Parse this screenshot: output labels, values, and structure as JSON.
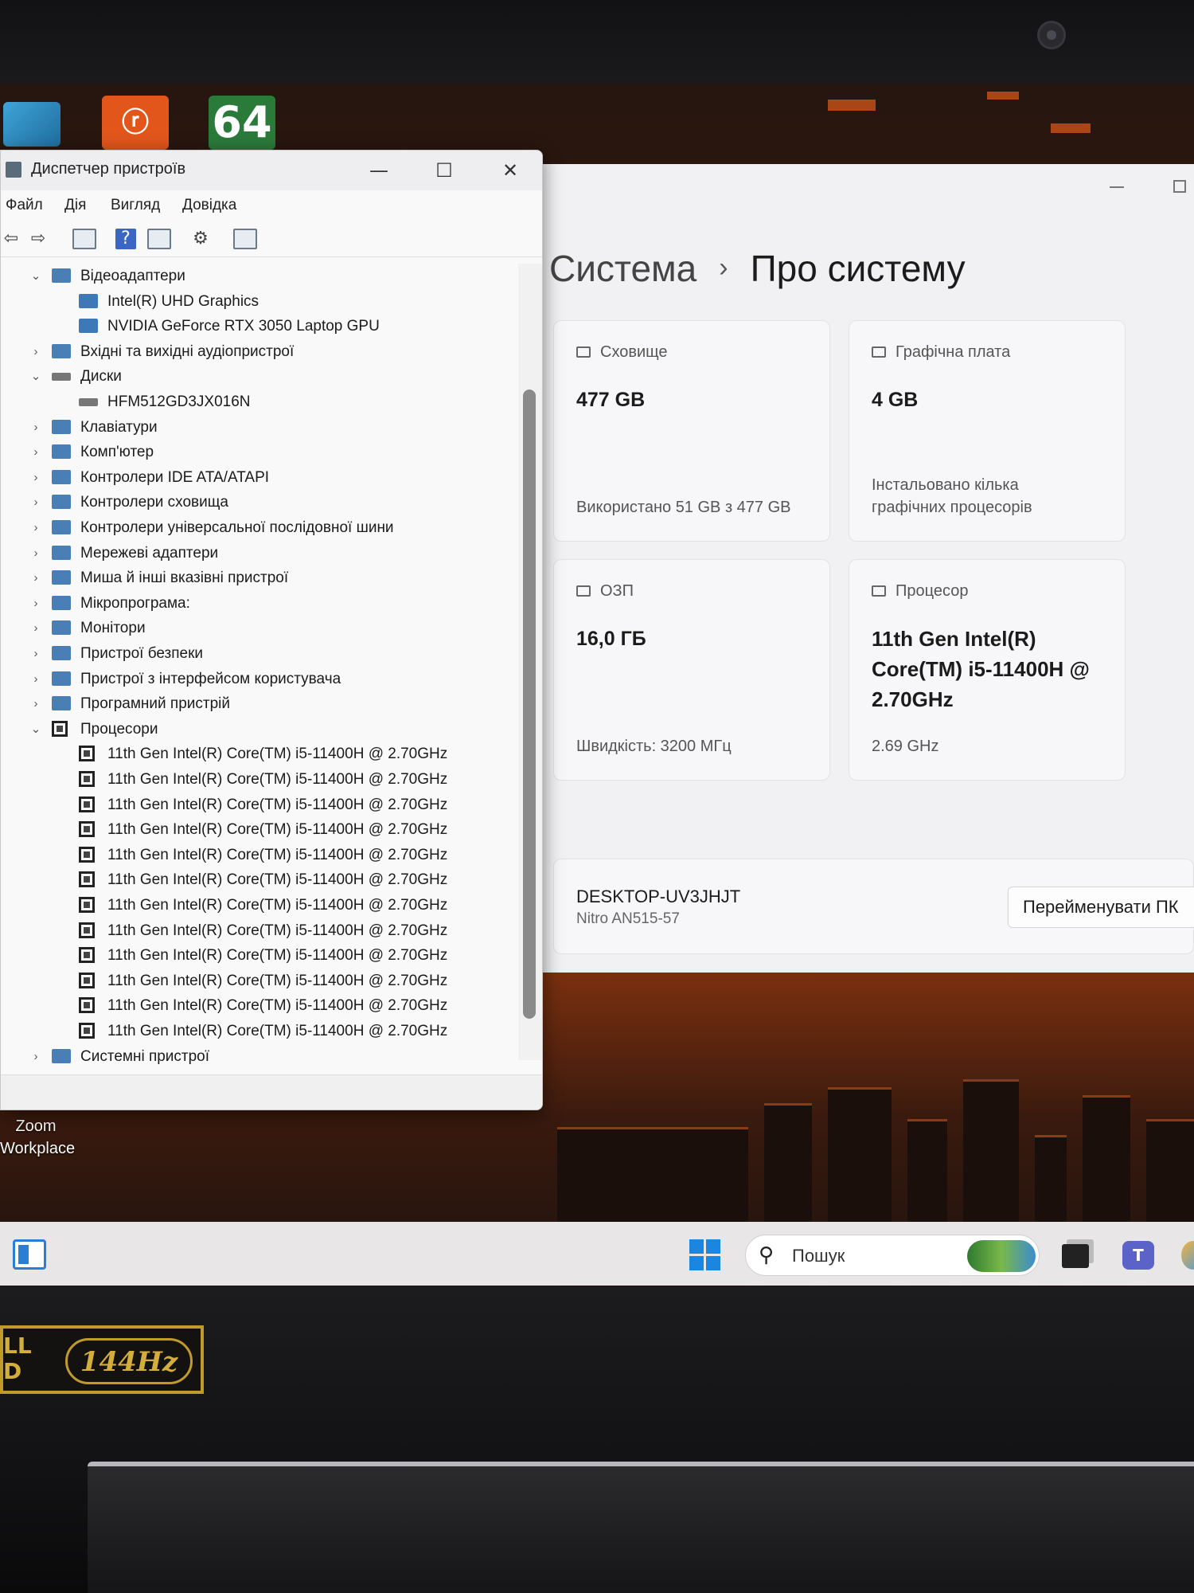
{
  "desktop": {
    "icons": [
      {
        "name": "blue-app",
        "label": ""
      },
      {
        "name": "reader",
        "label": "ⓡ"
      },
      {
        "name": "aida64",
        "label": "64"
      }
    ],
    "zoom_label_1": "Zoom",
    "zoom_label_2": "Workplace"
  },
  "device_manager": {
    "title": "Диспетчер пристроїв",
    "menu": [
      "Файл",
      "Дія",
      "Вигляд",
      "Довідка"
    ],
    "window_buttons": {
      "minimize": "—",
      "maximize": "☐",
      "close": "✕"
    },
    "tree": [
      {
        "label": "Відеоадаптери",
        "level": 0,
        "expanded": true,
        "icon": "display-adapter-icon"
      },
      {
        "label": "Intel(R) UHD Graphics",
        "level": 1,
        "icon": "gpu-icon"
      },
      {
        "label": "NVIDIA GeForce RTX 3050 Laptop GPU",
        "level": 1,
        "icon": "gpu-icon"
      },
      {
        "label": "Вхідні та вихідні аудіопристрої",
        "level": 0,
        "expanded": false,
        "icon": "speaker-icon"
      },
      {
        "label": "Диски",
        "level": 0,
        "expanded": true,
        "icon": "disk-icon"
      },
      {
        "label": "HFM512GD3JX016N",
        "level": 1,
        "icon": "disk-icon"
      },
      {
        "label": "Клавіатури",
        "level": 0,
        "expanded": false,
        "icon": "keyboard-icon"
      },
      {
        "label": "Комп'ютер",
        "level": 0,
        "expanded": false,
        "icon": "computer-icon"
      },
      {
        "label": "Контролери IDE ATA/ATAPI",
        "level": 0,
        "expanded": false,
        "icon": "ide-icon"
      },
      {
        "label": "Контролери сховища",
        "level": 0,
        "expanded": false,
        "icon": "storage-controller-icon"
      },
      {
        "label": "Контролери універсальної послідовної шини",
        "level": 0,
        "expanded": false,
        "icon": "usb-icon"
      },
      {
        "label": "Мережеві адаптери",
        "level": 0,
        "expanded": false,
        "icon": "network-icon"
      },
      {
        "label": "Миша й інші вказівні пристрої",
        "level": 0,
        "expanded": false,
        "icon": "mouse-icon"
      },
      {
        "label": "Мікропрограма:",
        "level": 0,
        "expanded": false,
        "icon": "firmware-icon"
      },
      {
        "label": "Монітори",
        "level": 0,
        "expanded": false,
        "icon": "monitor-icon"
      },
      {
        "label": "Пристрої безпеки",
        "level": 0,
        "expanded": false,
        "icon": "security-icon"
      },
      {
        "label": "Пристрої з інтерфейсом користувача",
        "level": 0,
        "expanded": false,
        "icon": "hid-icon"
      },
      {
        "label": "Програмний пристрій",
        "level": 0,
        "expanded": false,
        "icon": "software-device-icon"
      },
      {
        "label": "Процесори",
        "level": 0,
        "expanded": true,
        "icon": "processor-icon"
      },
      {
        "label": "11th Gen Intel(R) Core(TM) i5-11400H @ 2.70GHz",
        "level": 1,
        "icon": "cpu-icon"
      },
      {
        "label": "11th Gen Intel(R) Core(TM) i5-11400H @ 2.70GHz",
        "level": 1,
        "icon": "cpu-icon"
      },
      {
        "label": "11th Gen Intel(R) Core(TM) i5-11400H @ 2.70GHz",
        "level": 1,
        "icon": "cpu-icon"
      },
      {
        "label": "11th Gen Intel(R) Core(TM) i5-11400H @ 2.70GHz",
        "level": 1,
        "icon": "cpu-icon"
      },
      {
        "label": "11th Gen Intel(R) Core(TM) i5-11400H @ 2.70GHz",
        "level": 1,
        "icon": "cpu-icon"
      },
      {
        "label": "11th Gen Intel(R) Core(TM) i5-11400H @ 2.70GHz",
        "level": 1,
        "icon": "cpu-icon"
      },
      {
        "label": "11th Gen Intel(R) Core(TM) i5-11400H @ 2.70GHz",
        "level": 1,
        "icon": "cpu-icon"
      },
      {
        "label": "11th Gen Intel(R) Core(TM) i5-11400H @ 2.70GHz",
        "level": 1,
        "icon": "cpu-icon"
      },
      {
        "label": "11th Gen Intel(R) Core(TM) i5-11400H @ 2.70GHz",
        "level": 1,
        "icon": "cpu-icon"
      },
      {
        "label": "11th Gen Intel(R) Core(TM) i5-11400H @ 2.70GHz",
        "level": 1,
        "icon": "cpu-icon"
      },
      {
        "label": "11th Gen Intel(R) Core(TM) i5-11400H @ 2.70GHz",
        "level": 1,
        "icon": "cpu-icon"
      },
      {
        "label": "11th Gen Intel(R) Core(TM) i5-11400H @ 2.70GHz",
        "level": 1,
        "icon": "cpu-icon"
      },
      {
        "label": "Системні пристрої",
        "level": 0,
        "expanded": false,
        "icon": "system-devices-icon"
      }
    ]
  },
  "settings": {
    "breadcrumb_parent": "Система",
    "breadcrumb_sep": "›",
    "breadcrumb_current": "Про систему",
    "cards": {
      "storage": {
        "header": "Сховище",
        "value": "477 GB",
        "sub": "Використано 51 GB з 477 GB"
      },
      "gpu": {
        "header": "Графічна плата",
        "value": "4 GB",
        "sub_line1": "Інстальовано кілька",
        "sub_line2": "графічних процесорів"
      },
      "ram": {
        "header": "ОЗП",
        "value": "16,0 ГБ",
        "sub": "Швидкість: 3200 МГц"
      },
      "cpu": {
        "header": "Процесор",
        "value_line1": "11th Gen Intel(R)",
        "value_line2": "Core(TM) i5-11400H @",
        "value_line3": "2.70GHz",
        "sub": "2.69 GHz"
      }
    },
    "device_name": "DESKTOP-UV3JHJT",
    "device_model": "Nitro AN515-57",
    "rename_button": "Перейменувати ПК"
  },
  "taskbar": {
    "search_icon": "⚲",
    "search_placeholder": "Пошук",
    "teams_label": "T"
  },
  "bezel": {
    "sticker_fhd": "LL\nD",
    "sticker_hz": "144Hz"
  }
}
